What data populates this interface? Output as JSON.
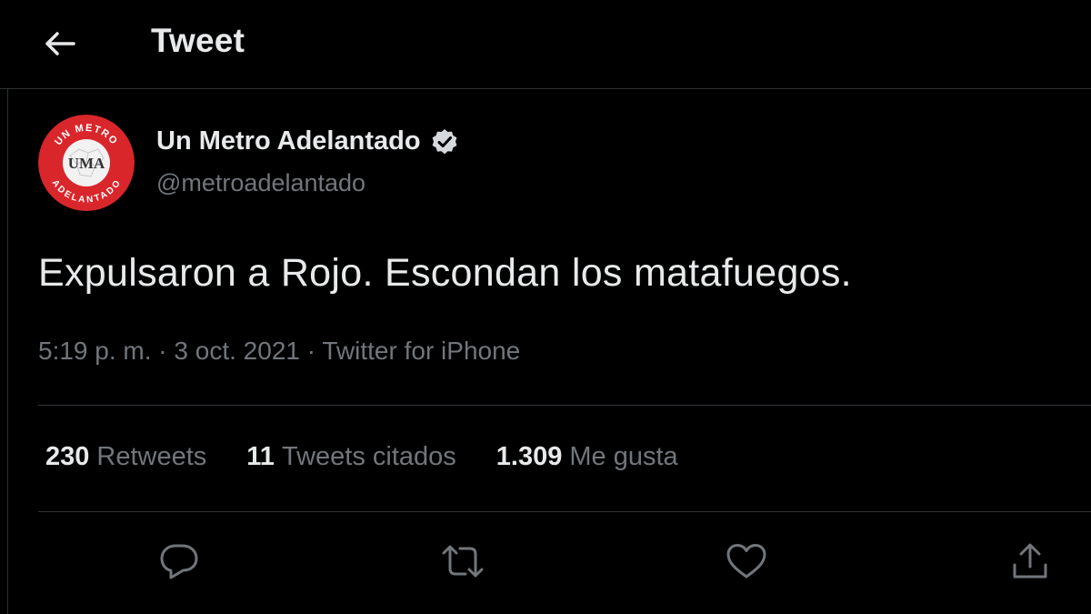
{
  "header": {
    "title": "Tweet",
    "back_icon": "arrow-left-icon"
  },
  "author": {
    "name": "Un Metro Adelantado",
    "handle": "@metroadelantado",
    "verified_icon": "verified-badge-icon",
    "avatar": {
      "top_text": "UN METRO",
      "center_text": "UMA",
      "bottom_text": "ADELANTADO",
      "ring_color": "#d9262b"
    }
  },
  "tweet": {
    "text": "Expulsaron a Rojo. Escondan los matafuegos.",
    "time": "5:19 p. m.",
    "date": "3 oct. 2021",
    "source": "Twitter for iPhone",
    "separator": "·"
  },
  "stats": {
    "retweets": {
      "count": "230",
      "label": "Retweets"
    },
    "quotes": {
      "count": "11",
      "label": "Tweets citados"
    },
    "likes": {
      "count": "1.309",
      "label": "Me gusta"
    }
  },
  "actions": [
    "reply-icon",
    "retweet-icon",
    "like-icon",
    "share-icon"
  ],
  "colors": {
    "background": "#000000",
    "text_primary": "#e7e9ea",
    "text_secondary": "#71767b",
    "divider": "#2f3336"
  }
}
